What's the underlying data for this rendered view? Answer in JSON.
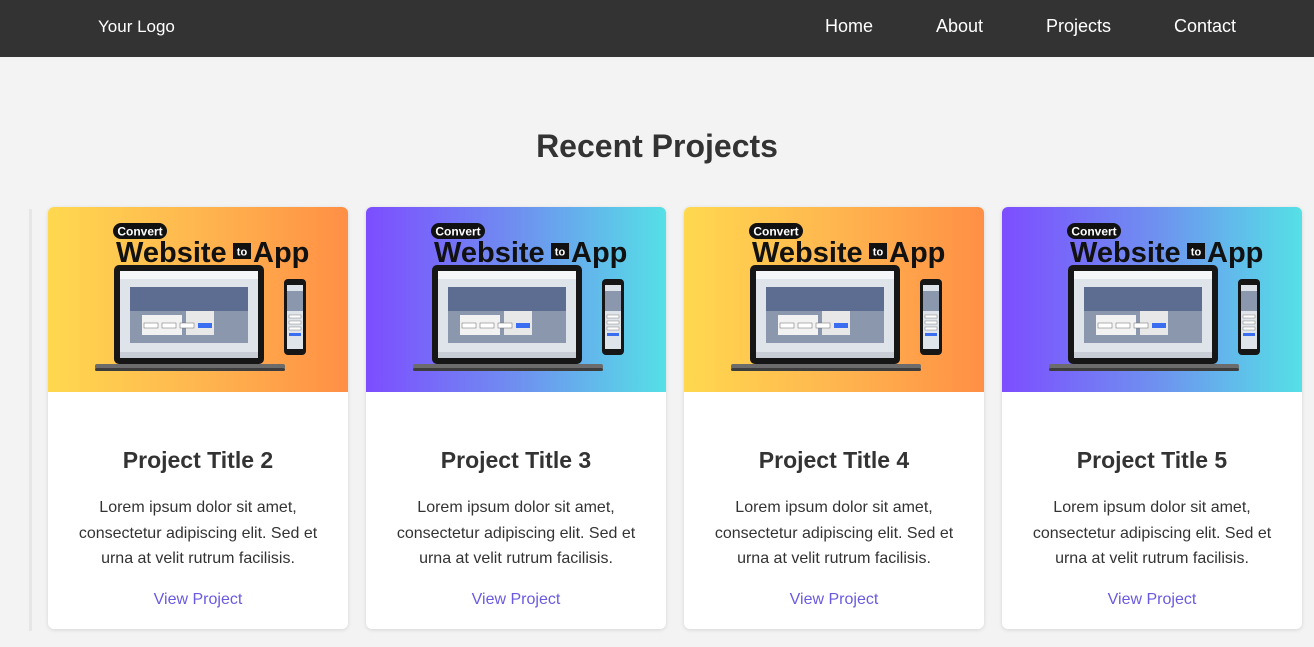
{
  "header": {
    "logo": "Your Logo",
    "nav": [
      {
        "label": "Home"
      },
      {
        "label": "About"
      },
      {
        "label": "Projects"
      },
      {
        "label": "Contact"
      }
    ]
  },
  "section": {
    "title": "Recent Projects"
  },
  "thumbnail_text": {
    "badge": "Convert",
    "word1": "Website",
    "connector": "to",
    "word2": "App"
  },
  "projects": [
    {
      "title": "Project Title 2",
      "description": "Lorem ipsum dolor sit amet, consectetur adipiscing elit. Sed et urna at velit rutrum facilisis.",
      "link": "View Project",
      "gradient": "warm"
    },
    {
      "title": "Project Title 3",
      "description": "Lorem ipsum dolor sit amet, consectetur adipiscing elit. Sed et urna at velit rutrum facilisis.",
      "link": "View Project",
      "gradient": "cool"
    },
    {
      "title": "Project Title 4",
      "description": "Lorem ipsum dolor sit amet, consectetur adipiscing elit. Sed et urna at velit rutrum facilisis.",
      "link": "View Project",
      "gradient": "warm"
    },
    {
      "title": "Project Title 5",
      "description": "Lorem ipsum dolor sit amet, consectetur adipiscing elit. Sed et urna at velit rutrum facilisis.",
      "link": "View Project",
      "gradient": "cool"
    }
  ],
  "colors": {
    "header_bg": "#333333",
    "page_bg": "#f3f3f3",
    "link": "#6a5ae0",
    "warm_gradient": [
      "#ffd84f",
      "#ff8f45"
    ],
    "cool_gradient": [
      "#7d4dff",
      "#55e0e6"
    ]
  }
}
